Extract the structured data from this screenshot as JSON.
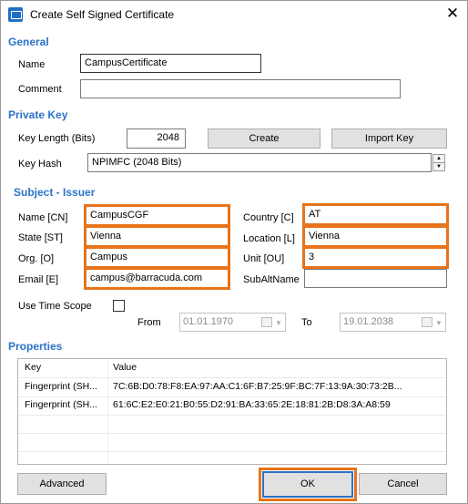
{
  "window": {
    "title": "Create Self Signed Certificate"
  },
  "general": {
    "heading": "General",
    "name_label": "Name",
    "name_value": "CampusCertificate",
    "comment_label": "Comment",
    "comment_value": ""
  },
  "private_key": {
    "heading": "Private Key",
    "key_length_label": "Key Length (Bits)",
    "key_length_value": "2048",
    "create_label": "Create",
    "import_label": "Import Key",
    "key_hash_label": "Key Hash",
    "key_hash_value": "NPIMFC (2048 Bits)"
  },
  "subject": {
    "heading": "Subject - Issuer",
    "name_cn_label": "Name [CN]",
    "name_cn_value": "CampusCGF",
    "state_label": "State [ST]",
    "state_value": "Vienna",
    "org_label": "Org. [O]",
    "org_value": "Campus",
    "email_label": "Email [E]",
    "email_value": "campus@barracuda.com",
    "country_label": "Country [C]",
    "country_value": "AT",
    "location_label": "Location [L]",
    "location_value": "Vienna",
    "unit_label": "Unit [OU]",
    "unit_value": "3",
    "subaltname_label": "SubAltName",
    "subaltname_value": "",
    "use_time_scope_label": "Use Time Scope",
    "use_time_scope_checked": false,
    "from_label": "From",
    "from_value": "01.01.1970",
    "to_label": "To",
    "to_value": "19.01.2038"
  },
  "properties": {
    "heading": "Properties",
    "columns": [
      "Key",
      "Value"
    ],
    "rows": [
      {
        "key": "Fingerprint (SH...",
        "value": "7C:6B:D0:78:F8:EA:97:AA:C1:6F:B7:25:9F:BC:7F:13:9A:30:73:2B..."
      },
      {
        "key": "Fingerprint (SH...",
        "value": "61:6C:E2:E0:21:B0:55:D2:91:BA:33:65:2E:18:81:2B:D8:3A:A8:59"
      }
    ]
  },
  "footer": {
    "advanced_label": "Advanced",
    "ok_label": "OK",
    "cancel_label": "Cancel"
  },
  "colors": {
    "accent": "#2b73c9",
    "highlight": "#e8731a"
  }
}
